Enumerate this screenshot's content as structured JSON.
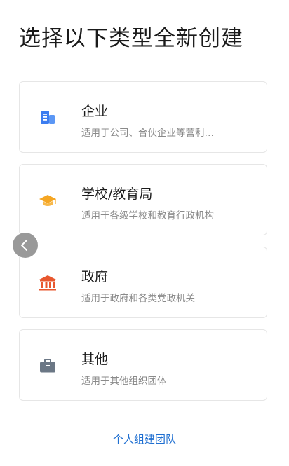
{
  "page": {
    "title": "选择以下类型全新创建"
  },
  "options": [
    {
      "name": "企业",
      "desc": "适用于公司、合伙企业等营利…",
      "icon": "building-icon",
      "icon_color": "#3b7cf0"
    },
    {
      "name": "学校/教育局",
      "desc": "适用于各级学校和教育行政机构",
      "icon": "graduation-cap-icon",
      "icon_color": "#f5a623"
    },
    {
      "name": "政府",
      "desc": "适用于政府和各类党政机关",
      "icon": "government-building-icon",
      "icon_color": "#e8572e"
    },
    {
      "name": "其他",
      "desc": "适用于其他组织团体",
      "icon": "briefcase-icon",
      "icon_color": "#6b7785"
    }
  ],
  "back_button": {
    "icon": "chevron-left-icon"
  },
  "footer": {
    "team_link": "个人组建团队",
    "link_color": "#1f6fd1"
  }
}
